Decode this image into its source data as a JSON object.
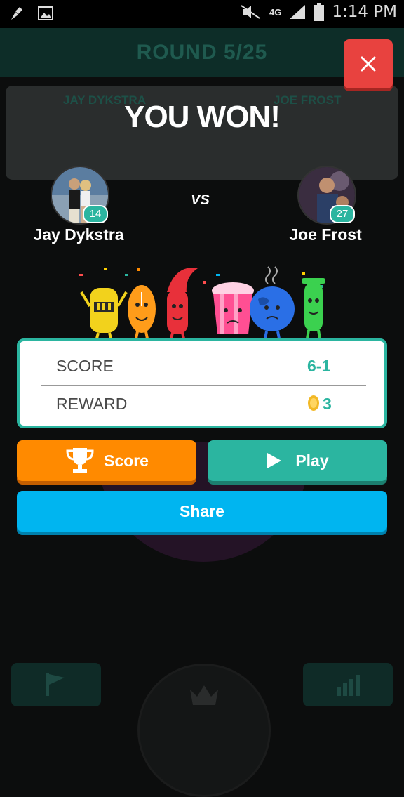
{
  "status_bar": {
    "time": "1:14 PM",
    "network": "4G",
    "icons": [
      "broom-icon",
      "image-icon",
      "mute-icon",
      "signal-icon",
      "battery-icon"
    ]
  },
  "background": {
    "round_title": "ROUND 5/25",
    "player1_name": "JAY DYKSTRA",
    "player2_name": "JOE FROST"
  },
  "result": {
    "headline": "YOU WON!",
    "vs": "VS"
  },
  "player1": {
    "name": "Jay Dykstra",
    "level": "14"
  },
  "player2": {
    "name": "Joe Frost",
    "level": "27"
  },
  "score_card": {
    "score_label": "SCORE",
    "score_value": "6-1",
    "reward_label": "REWARD",
    "reward_value": "3"
  },
  "buttons": {
    "score": "Score",
    "play": "Play",
    "share": "Share"
  },
  "colors": {
    "accent_teal": "#2bb5a0",
    "close_red": "#e8423f",
    "score_orange": "#ff8a00",
    "share_blue": "#00b5f0"
  }
}
